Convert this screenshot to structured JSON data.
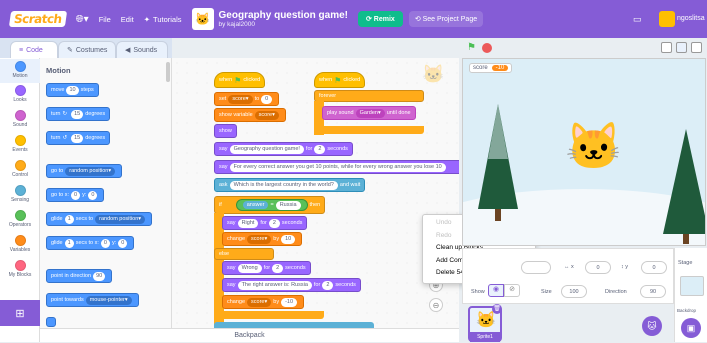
{
  "menubar": {
    "logo": "Scratch",
    "file": "File",
    "edit": "Edit",
    "tutorials": "Tutorials",
    "project_title": "Geography question game!",
    "project_author": "by kajal2000",
    "remix": "Remix",
    "see_project_page": "See Project Page",
    "username": "ngoslitsa"
  },
  "tabs": {
    "code": "Code",
    "costumes": "Costumes",
    "sounds": "Sounds"
  },
  "categories": [
    "Motion",
    "Looks",
    "Sound",
    "Events",
    "Control",
    "Sensing",
    "Operators",
    "Variables",
    "My Blocks"
  ],
  "palette": {
    "heading": "Motion",
    "move": "move",
    "move_val": "10",
    "move_unit": "steps",
    "turn_right": "turn",
    "turn_right_val": "15",
    "turn_left": "turn",
    "turn_left_val": "15",
    "degrees": "degrees",
    "go_to": "go to",
    "random_position": "random position",
    "go_to_x": "go to x:",
    "go_y": "y:",
    "x_val": "0",
    "y_val": "0",
    "glide": "glide",
    "glide_secs": "1",
    "secs_to": "secs to",
    "glide_random": "random position",
    "secs_to_x": "secs to x:",
    "point_dir": "point in direction",
    "point_dir_val": "90",
    "point_towards": "point towards",
    "mouse_pointer": "mouse-pointer"
  },
  "script": {
    "when_clicked": "when",
    "clicked": "clicked",
    "set": "set",
    "score": "score",
    "to": "to",
    "set_val": "0",
    "show_variable": "show variable",
    "show": "show",
    "say": "say",
    "geo_game": "Geography question game!",
    "for": "for",
    "secs_val": "2",
    "seconds": "seconds",
    "long_msg": "For every correct answer you get 10 points, while for every wrong answer you lose 10",
    "ask": "ask",
    "question": "Which is the largest country in the world?",
    "and_wait": "and wait",
    "if": "if",
    "answer": "answer",
    "eq_sign": "=",
    "russia": "Russia",
    "then": "then",
    "right": "Right",
    "change": "change",
    "by": "by",
    "change_up": "10",
    "else": "else",
    "wrong": "Wrong",
    "right_answer": "The right answer is: Russia",
    "change_down": "-10",
    "forever": "forever",
    "play_sound": "play sound",
    "garden": "Garden",
    "until_done": "until done"
  },
  "context_menu": {
    "undo": "Undo",
    "redo": "Redo",
    "clean_up": "Clean up Blocks",
    "add_comment": "Add Comment",
    "delete": "Delete 54 Blocks"
  },
  "backpack": "Backpack",
  "stage": {
    "monitor_label": "score",
    "monitor_value": "-10"
  },
  "sprite_info": {
    "x_label": "x",
    "x_val": "0",
    "y_label": "y",
    "y_val": "0",
    "show_label": "Show",
    "size_label": "Size",
    "size_val": "100",
    "direction_label": "Direction",
    "direction_val": "90",
    "sprite_name": "Sprite1"
  },
  "stage_panel": {
    "stage_label": "Stage",
    "backdrops_label": "Backdrop"
  },
  "colors": {
    "menubar": "#855cd6",
    "motion": "#4c97ff",
    "events": "#ffbf00",
    "variables": "#ff8c1a",
    "looks": "#9966ff",
    "sound": "#cf63cf",
    "control": "#ffab19",
    "sensing": "#5cb1d6",
    "operators": "#59c059",
    "remix": "#0fbd8c"
  }
}
